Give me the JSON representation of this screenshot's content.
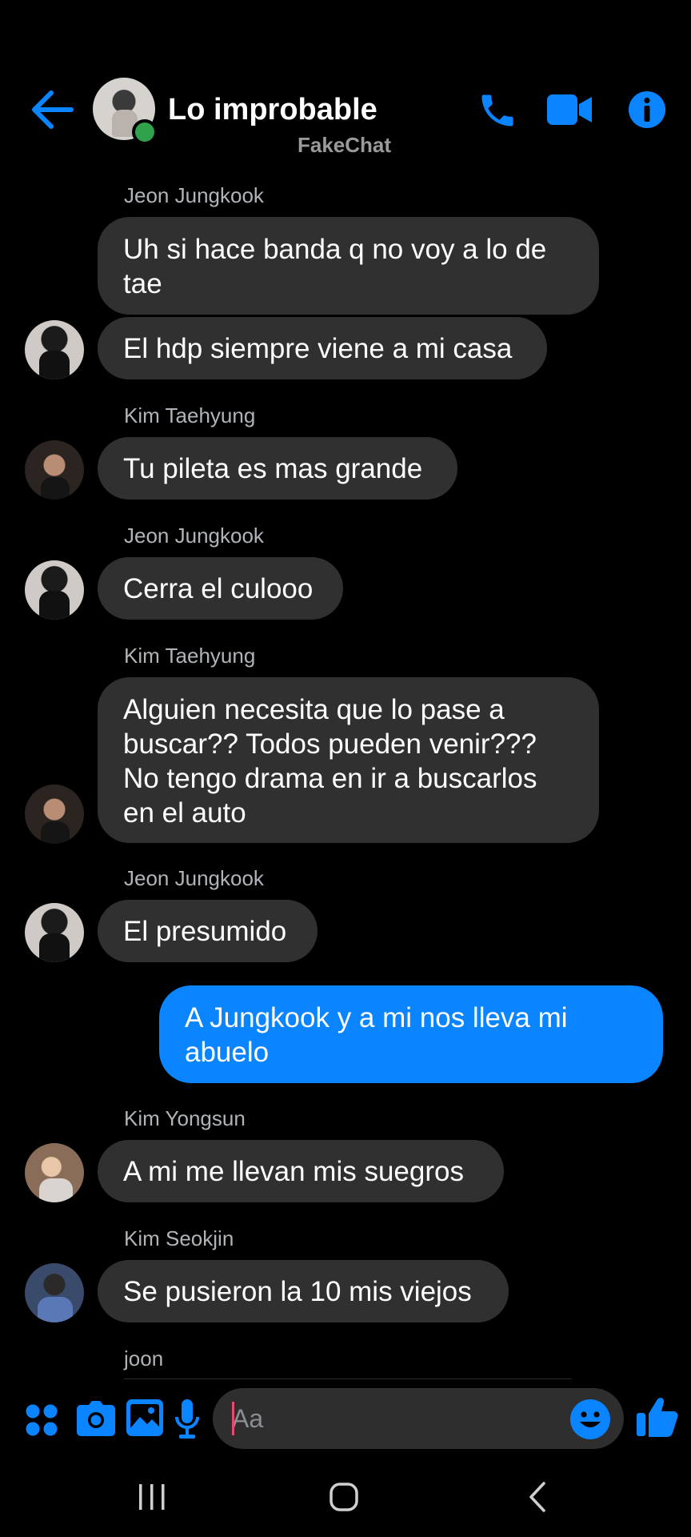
{
  "header": {
    "title": "Lo improbable",
    "subtitle": "FakeChat",
    "icons": [
      "back-arrow-icon",
      "phone-icon",
      "video-camera-icon",
      "info-icon"
    ],
    "accent_color": "#0a84ff",
    "online_color": "#31a24c"
  },
  "messages": [
    {
      "sender": "Jeon Jungkook",
      "text": "Uh si hace banda q no voy a lo de tae"
    },
    {
      "text": "El hdp siempre viene a mi casa"
    },
    {
      "sender": "Kim Taehyung",
      "text": "Tu pileta es mas grande"
    },
    {
      "sender": "Jeon Jungkook",
      "text": "Cerra el culooo"
    },
    {
      "sender": "Kim Taehyung",
      "text": "Alguien necesita que lo pase a buscar?? Todos pueden venir??? No tengo drama en ir a buscarlos en el auto"
    },
    {
      "sender": "Jeon Jungkook",
      "text": "El presumido"
    },
    {
      "own": true,
      "text": "A Jungkook y a mi nos lleva mi abuelo"
    },
    {
      "sender": "Kim Yongsun",
      "text": "A mi me llevan mis suegros"
    },
    {
      "sender": "Kim Seokjin",
      "text": "Se pusieron la 10 mis viejos"
    },
    {
      "sender": "joon"
    }
  ],
  "composer": {
    "placeholder": "Aa",
    "icons": [
      "apps-icon",
      "camera-icon",
      "gallery-icon",
      "microphone-icon",
      "emoji-icon",
      "thumbs-up-icon"
    ]
  },
  "colors": {
    "background": "#000000",
    "incoming_bubble": "#303030",
    "outgoing_bubble": "#0a84ff",
    "sender_label": "#b0b3b8"
  }
}
